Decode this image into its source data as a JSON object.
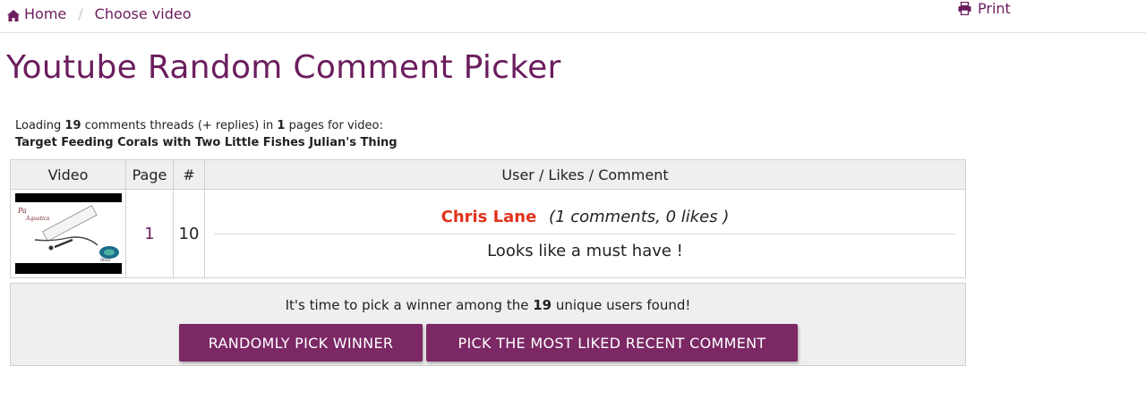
{
  "breadcrumb": {
    "home_label": "Home",
    "separator": "/",
    "current_label": "Choose video"
  },
  "header": {
    "print_label": "Print"
  },
  "page_title": "Youtube Random Comment Picker",
  "loading": {
    "prefix": "Loading ",
    "thread_count": "19",
    "middle": " comments threads (+ replies) in ",
    "page_count": "1",
    "suffix": " pages for video:",
    "video_title": "Target Feeding Corals with Two Little Fishes Julian's Thing"
  },
  "table": {
    "headers": [
      "Video",
      "Page",
      "#",
      "User / Likes / Comment"
    ],
    "rows": [
      {
        "page": "1",
        "index": "10",
        "user": "Chris Lane",
        "stats": "(1 comments, 0 likes )",
        "comment": "Looks like a must have !"
      }
    ]
  },
  "winner": {
    "prefix": "It's time to pick a winner among the ",
    "unique_count": "19",
    "suffix": " unique users found!",
    "random_button": "RANDOMLY PICK WINNER",
    "liked_button": "PICK THE MOST LIKED RECENT COMMENT"
  },
  "colors": {
    "accent": "#6b1d5e",
    "button": "#7b2865",
    "username": "#e2321d"
  },
  "icons": {
    "home": "home-icon",
    "print": "print-icon"
  }
}
